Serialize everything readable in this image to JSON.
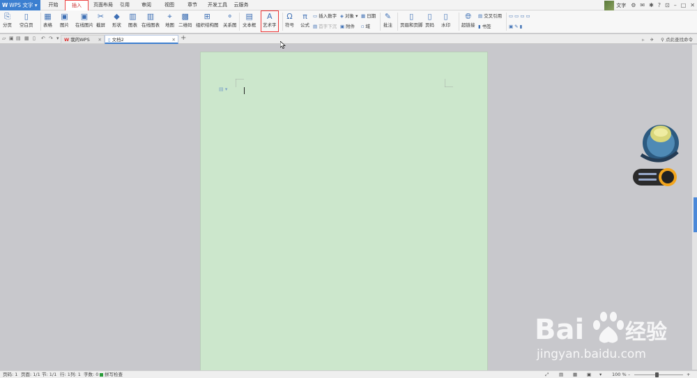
{
  "app": {
    "title": "WPS 文字",
    "logo": "W"
  },
  "menu": {
    "tabs": [
      "开始",
      "插入",
      "页面布局",
      "引用",
      "审阅",
      "视图",
      "章节",
      "开发工具",
      "云服务"
    ],
    "active_tab": "插入",
    "user": "文字",
    "help": "?"
  },
  "ribbon": {
    "page_break": "分页",
    "blank_page": "空白页",
    "table": "表格",
    "picture": "图片",
    "online_picture": "在线图片",
    "screenshot": "截屏",
    "shapes": "形状",
    "chart": "图表",
    "online_chart": "在线图表",
    "map": "地图",
    "qrcode": "二维码",
    "smartart": "组织结构图",
    "relation": "关系图",
    "textbox": "文本框",
    "wordart": "艺术字",
    "symbol": "符号",
    "formula": "公式",
    "insert_number": "插入数字",
    "object": "对象",
    "date": "日期",
    "dropcap": "首字下沉",
    "attachment": "附件",
    "field": "域",
    "comment": "批注",
    "header_footer": "页眉和页脚",
    "page_number": "页码",
    "watermark": "水印",
    "hyperlink": "超链接",
    "crossref": "交叉引用",
    "bookmark": "书签"
  },
  "tabs": {
    "items": [
      {
        "label": "我的WPS",
        "active": false
      },
      {
        "label": "文档2",
        "active": true
      }
    ],
    "help_search": "点此查找命令"
  },
  "status": {
    "page_no": "页码: 1",
    "pages": "页面: 1/1",
    "section": "节: 1/1",
    "row": "行: 1",
    "col": "列: 1",
    "words": "字数: 0",
    "spellcheck": "拼写检查",
    "zoom": "100 %",
    "zoom_level": 0.45
  },
  "watermark": {
    "url": "jingyan.baidu.com"
  },
  "colors": {
    "accent": "#3c7fd0",
    "page": "#cce7cc",
    "highlight": "#e33333"
  }
}
